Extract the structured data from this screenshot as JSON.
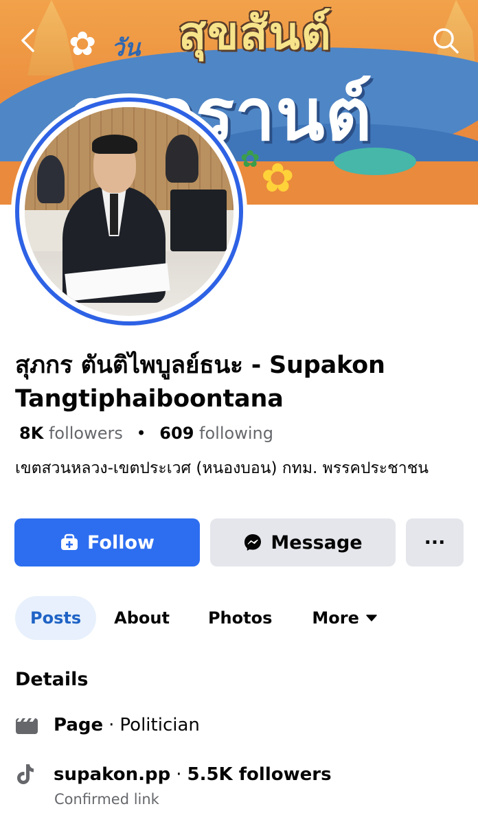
{
  "cover": {
    "banner_small": "วัน",
    "banner_title": "สุขสันต์",
    "banner_big": "สงกรานต์",
    "flower_glyph": "✿"
  },
  "nav": {
    "back_icon": "chevron-left-icon",
    "search_icon": "search-icon"
  },
  "profile": {
    "name": "สุภกร ตันติไพบูลย์ธนะ - Supakon Tangtiphaiboontana",
    "followers_count": "8K",
    "followers_label": "followers",
    "separator": "•",
    "following_count": "609",
    "following_label": "following",
    "bio": "เขตสวนหลวง-เขตประเวศ (หนองบอน) กทม. พรรคประชาชน"
  },
  "actions": {
    "follow_label": "Follow",
    "message_label": "Message",
    "more_label": "···"
  },
  "tabs": [
    {
      "label": "Posts",
      "active": true
    },
    {
      "label": "About",
      "active": false
    },
    {
      "label": "Photos",
      "active": false
    },
    {
      "label": "More",
      "active": false
    }
  ],
  "details": {
    "title": "Details",
    "page_label": "Page",
    "page_separator": "·",
    "page_category": "Politician",
    "tiktok_handle": "supakon.pp",
    "tiktok_separator": "·",
    "tiktok_followers": "5.5K followers",
    "tiktok_note": "Confirmed link"
  },
  "colors": {
    "accent": "#2d6ef0",
    "tab_active_bg": "#e7f0fc",
    "tab_active_text": "#1f63c6",
    "secondary_btn": "#e4e6eb",
    "muted_text": "#65676b"
  }
}
